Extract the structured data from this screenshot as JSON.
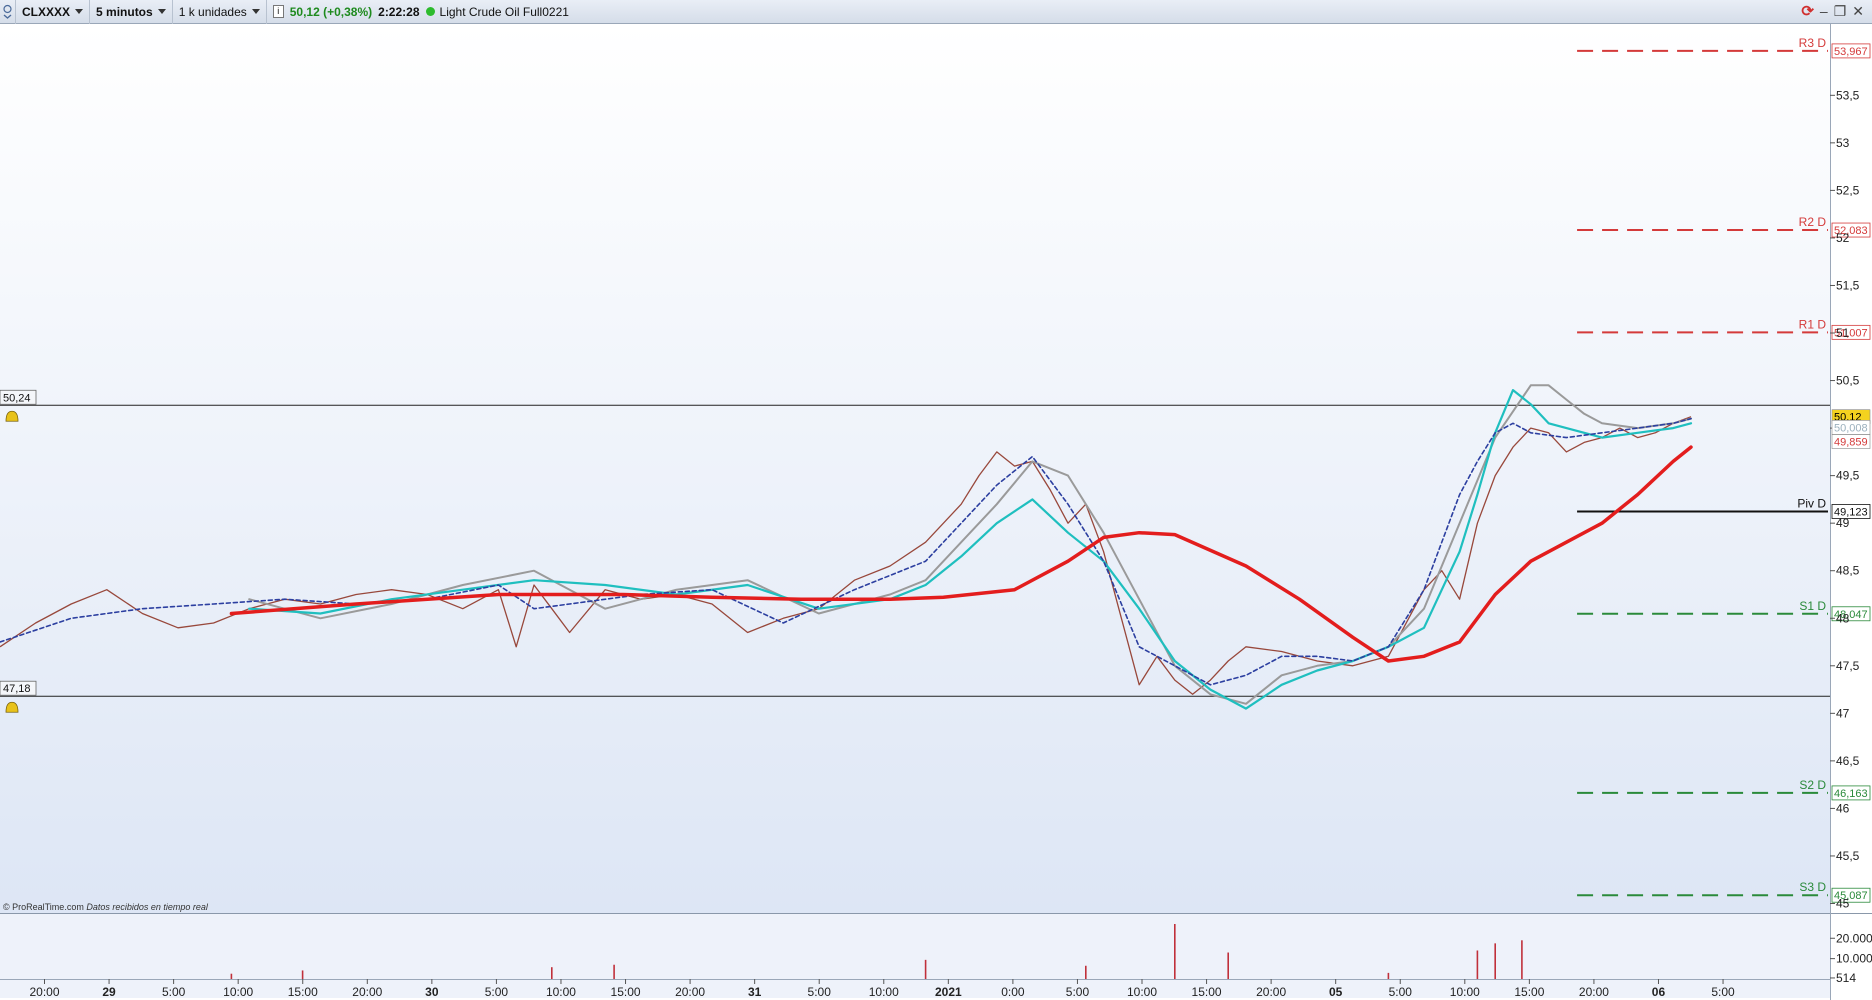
{
  "toolbar": {
    "symbol": "CLXXXX",
    "timeframe": "5 minutos",
    "units": "1 k unidades",
    "price_change": "50,12 (+0,38%)",
    "time": "2:22:28",
    "instrument": "Light Crude Oil Full0221"
  },
  "credit": {
    "brand": "© ProRealTime.com",
    "note": "Datos recibidos en tiempo real"
  },
  "chart_data": {
    "type": "line",
    "x_ticks": [
      "20:00",
      "29",
      "5:00",
      "10:00",
      "15:00",
      "20:00",
      "30",
      "5:00",
      "10:00",
      "15:00",
      "20:00",
      "31",
      "5:00",
      "10:00",
      "2021",
      "0:00",
      "5:00",
      "10:00",
      "15:00",
      "20:00",
      "05",
      "5:00",
      "10:00",
      "15:00",
      "20:00",
      "06",
      "5:00"
    ],
    "bold_ticks": [
      "29",
      "30",
      "31",
      "2021",
      "05",
      "06"
    ],
    "y_ticks": [
      "53,5",
      "53",
      "52,5",
      "52",
      "51,5",
      "51",
      "50,5",
      "50",
      "49,5",
      "49",
      "48,5",
      "48",
      "47,5",
      "47",
      "46,5",
      "46",
      "45,5",
      "45"
    ],
    "ylim": [
      44.9,
      54.25
    ],
    "x_range": [
      0,
      100
    ],
    "horizontal_levels": [
      {
        "name": "R3 D",
        "value": 53.967,
        "label": "53,967",
        "color": "#d43a3a"
      },
      {
        "name": "R2 D",
        "value": 52.083,
        "label": "52,083",
        "color": "#d43a3a"
      },
      {
        "name": "R1 D",
        "value": 51.007,
        "label": "51,007",
        "color": "#d43a3a"
      },
      {
        "name": "Piv D",
        "value": 49.123,
        "label": "49,123",
        "color": "#111111"
      },
      {
        "name": "S1 D",
        "value": 48.047,
        "label": "48,047",
        "color": "#2a8a3a"
      },
      {
        "name": "S2 D",
        "value": 46.163,
        "label": "46,163",
        "color": "#2a8a3a"
      },
      {
        "name": "S3 D",
        "value": 45.087,
        "label": "45,087",
        "color": "#2a8a3a"
      }
    ],
    "levels_start_x": 88.6,
    "alert_lines": [
      {
        "value": 50.24,
        "label": "50,24"
      },
      {
        "value": 47.18,
        "label": "47,18"
      }
    ],
    "price_tags": [
      {
        "value": 50.12,
        "label": "50,12",
        "bg": "#f4d21f",
        "color": "#000000"
      },
      {
        "value": 50.008,
        "label": "50,008",
        "bg": "#ffffff",
        "color": "#9bb0bd"
      },
      {
        "value": 49.859,
        "label": "49,859",
        "bg": "#ffffff",
        "color": "#d43a3a"
      }
    ],
    "price_series": {
      "x": [
        0,
        2,
        4,
        6,
        8,
        10,
        12,
        14,
        16,
        18,
        20,
        22,
        24,
        26,
        28,
        29,
        30,
        31,
        32,
        34,
        36,
        38,
        40,
        42,
        44,
        46,
        48,
        50,
        52,
        54,
        55,
        56,
        57,
        58,
        59,
        60,
        61,
        62,
        63,
        64,
        65,
        66,
        67,
        68,
        69,
        70,
        72,
        74,
        76,
        78,
        80,
        81,
        82,
        83,
        84,
        85,
        86,
        87,
        88,
        89,
        90,
        91,
        92,
        93,
        94,
        95
      ],
      "y": [
        47.7,
        47.95,
        48.15,
        48.3,
        48.05,
        47.9,
        47.95,
        48.1,
        48.2,
        48.15,
        48.25,
        48.3,
        48.25,
        48.1,
        48.3,
        47.7,
        48.35,
        48.1,
        47.85,
        48.3,
        48.2,
        48.25,
        48.15,
        47.85,
        48.0,
        48.1,
        48.4,
        48.55,
        48.8,
        49.2,
        49.5,
        49.75,
        49.6,
        49.65,
        49.35,
        49.0,
        49.2,
        48.7,
        48.0,
        47.3,
        47.6,
        47.35,
        47.2,
        47.35,
        47.55,
        47.7,
        47.65,
        47.55,
        47.5,
        47.6,
        48.3,
        48.5,
        48.2,
        49.0,
        49.5,
        49.8,
        50.0,
        49.95,
        49.75,
        49.85,
        49.9,
        50.0,
        49.9,
        49.95,
        50.05,
        50.12
      ]
    },
    "series": [
      {
        "color": "#e31d1d",
        "x": [
          13,
          20,
          28,
          35,
          40,
          45,
          50,
          53,
          57,
          60,
          62,
          64,
          66,
          70,
          73,
          76,
          78,
          80,
          82,
          84,
          86,
          88,
          90,
          92,
          94,
          95
        ],
        "y": [
          48.05,
          48.15,
          48.25,
          48.25,
          48.22,
          48.2,
          48.2,
          48.22,
          48.3,
          48.6,
          48.85,
          48.9,
          48.88,
          48.55,
          48.2,
          47.8,
          47.55,
          47.6,
          47.75,
          48.25,
          48.6,
          48.8,
          49.0,
          49.3,
          49.65,
          49.8
        ]
      },
      {
        "color": "#1fbfbf",
        "x": [
          14,
          18,
          22,
          26,
          30,
          34,
          38,
          42,
          46,
          50,
          52,
          54,
          56,
          58,
          60,
          62,
          64,
          66,
          68,
          70,
          72,
          74,
          76,
          78,
          80,
          81,
          82,
          83,
          84,
          85,
          86,
          87,
          88,
          90,
          92,
          94,
          95
        ],
        "y": [
          48.1,
          48.05,
          48.2,
          48.3,
          48.4,
          48.35,
          48.25,
          48.35,
          48.1,
          48.2,
          48.35,
          48.65,
          49.0,
          49.25,
          48.9,
          48.6,
          48.1,
          47.55,
          47.25,
          47.05,
          47.3,
          47.45,
          47.55,
          47.7,
          47.9,
          48.3,
          48.7,
          49.3,
          49.95,
          50.4,
          50.25,
          50.05,
          50.0,
          49.9,
          49.95,
          50.0,
          50.05
        ]
      },
      {
        "color": "#9a9a9a",
        "x": [
          14,
          18,
          22,
          26,
          30,
          34,
          38,
          42,
          46,
          50,
          52,
          54,
          56,
          58,
          60,
          62,
          64,
          66,
          68,
          70,
          72,
          74,
          76,
          78,
          80,
          82,
          84,
          86,
          87,
          88,
          89,
          90,
          92,
          94,
          95
        ],
        "y": [
          48.2,
          48.0,
          48.15,
          48.35,
          48.5,
          48.1,
          48.3,
          48.4,
          48.05,
          48.25,
          48.4,
          48.8,
          49.2,
          49.65,
          49.5,
          48.9,
          48.2,
          47.5,
          47.2,
          47.1,
          47.4,
          47.5,
          47.55,
          47.7,
          48.1,
          49.0,
          49.9,
          50.45,
          50.45,
          50.3,
          50.15,
          50.05,
          50.0,
          50.05,
          50.1
        ]
      },
      {
        "color": "#2c3fa0",
        "x": [
          0,
          4,
          8,
          12,
          16,
          20,
          24,
          28,
          30,
          32,
          36,
          40,
          44,
          48,
          52,
          54,
          56,
          58,
          60,
          62,
          64,
          66,
          68,
          70,
          72,
          74,
          76,
          78,
          80,
          82,
          83,
          84,
          85,
          86,
          88,
          90,
          92,
          94,
          95
        ],
        "y": [
          47.75,
          48.0,
          48.1,
          48.15,
          48.2,
          48.15,
          48.2,
          48.35,
          48.1,
          48.15,
          48.25,
          48.3,
          47.95,
          48.3,
          48.6,
          49.0,
          49.4,
          49.7,
          49.2,
          48.6,
          47.7,
          47.5,
          47.3,
          47.4,
          47.6,
          47.6,
          47.55,
          47.7,
          48.3,
          49.3,
          49.65,
          49.95,
          50.05,
          49.95,
          49.9,
          49.95,
          50.0,
          50.05,
          50.1
        ]
      }
    ],
    "volume_axis": [
      "20.000",
      "10.000",
      "514"
    ],
    "volume_spikes": [
      {
        "x": 13,
        "v": 2600
      },
      {
        "x": 17,
        "v": 4200
      },
      {
        "x": 31,
        "v": 5800
      },
      {
        "x": 34.5,
        "v": 7000
      },
      {
        "x": 52,
        "v": 9400
      },
      {
        "x": 61,
        "v": 6500
      },
      {
        "x": 66,
        "v": 27000
      },
      {
        "x": 69,
        "v": 13000
      },
      {
        "x": 78,
        "v": 3000
      },
      {
        "x": 83,
        "v": 14000
      },
      {
        "x": 84,
        "v": 17500
      },
      {
        "x": 85.5,
        "v": 19000
      }
    ],
    "volume_max": 27000
  }
}
